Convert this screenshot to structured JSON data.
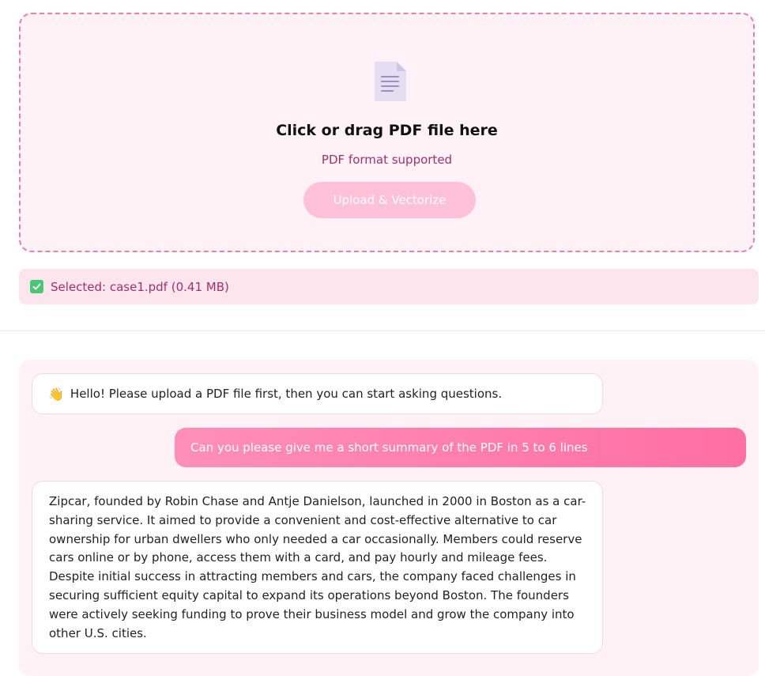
{
  "upload": {
    "icon": "document-icon",
    "title": "Click or drag PDF file here",
    "subtitle": "PDF format supported",
    "button_label": "Upload & Vectorize"
  },
  "selected_file": {
    "icon": "check-icon",
    "text": "Selected: case1.pdf (0.41 MB)"
  },
  "chat": {
    "messages": [
      {
        "role": "bot",
        "icon": "wave-icon",
        "text": "Hello! Please upload a PDF file first, then you can start asking questions."
      },
      {
        "role": "user",
        "text": "Can you please give me a short summary of the PDF in 5 to 6 lines"
      },
      {
        "role": "bot",
        "text": "Zipcar, founded by Robin Chase and Antje Danielson, launched in 2000 in Boston as a car-sharing service. It aimed to provide a convenient and cost-effective alternative to car ownership for urban dwellers who only needed a car occasionally. Members could reserve cars online or by phone, access them with a card, and pay hourly and mileage fees. Despite initial success in attracting members and cars, the company faced challenges in securing sufficient equity capital to expand its operations beyond Boston. The founders were actively seeking funding to prove their business model and grow the company into other U.S. cities."
      }
    ]
  },
  "colors": {
    "accent": "#ff6fa2",
    "dropzone_border": "#ec7ea8",
    "dropzone_bg": "#fff2f6",
    "secondary_text": "#a3306b"
  }
}
